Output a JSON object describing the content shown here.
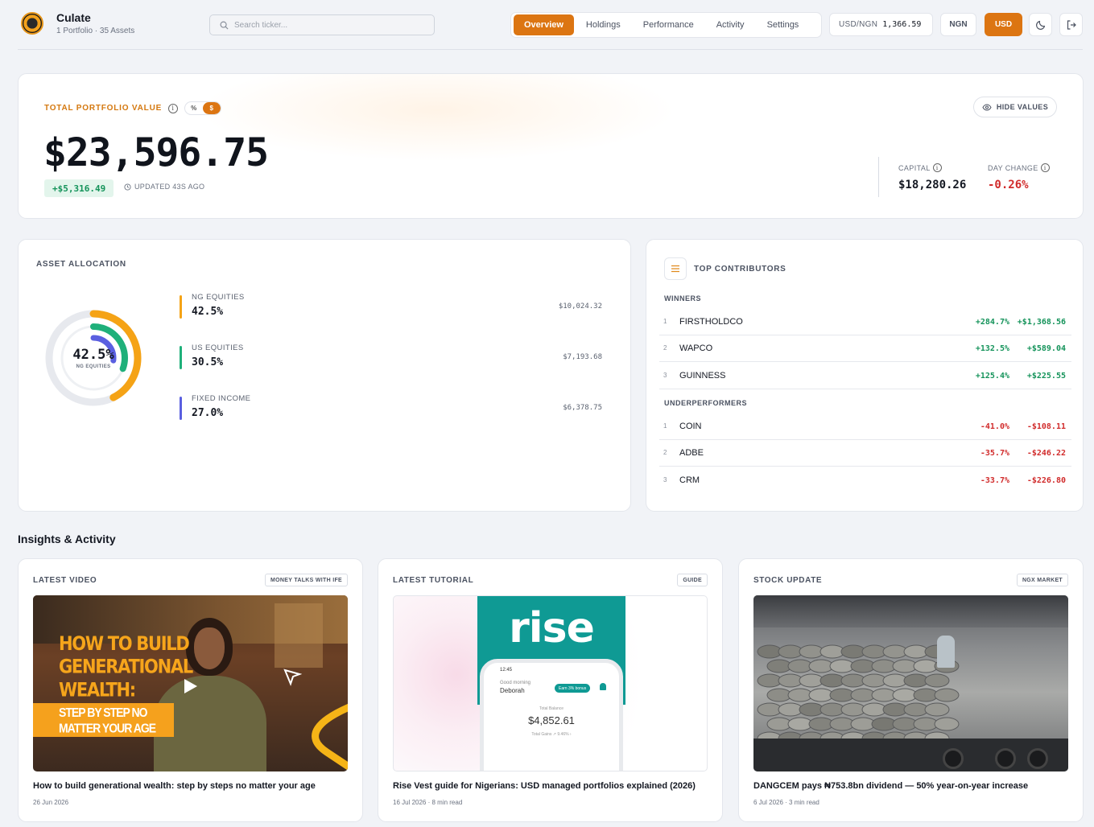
{
  "header": {
    "app_name": "Culate",
    "app_sub": "1 Portfolio · 35 Assets",
    "search_placeholder": "Search ticker...",
    "tabs": [
      {
        "label": "Overview",
        "active": true
      },
      {
        "label": "Holdings",
        "active": false
      },
      {
        "label": "Performance",
        "active": false
      },
      {
        "label": "Activity",
        "active": false
      },
      {
        "label": "Settings",
        "active": false
      }
    ],
    "fx_label": "USD/NGN",
    "fx_value": "1,366.59",
    "currency_ngn": "NGN",
    "currency_usd": "USD",
    "active_currency": "USD",
    "icons": [
      "moon-icon",
      "logout-icon"
    ]
  },
  "hero": {
    "label": "TOTAL PORTFOLIO VALUE",
    "toggle_pct": "%",
    "toggle_usd": "$",
    "hide_values": "HIDE VALUES",
    "total_value": "$23,596.75",
    "gain": "+$5,316.49",
    "updated": "UPDATED 43S AGO",
    "capital_label": "CAPITAL",
    "capital_value": "$18,280.26",
    "day_change_label": "DAY CHANGE",
    "day_change_value": "-0.26%"
  },
  "allocation": {
    "title": "ASSET ALLOCATION",
    "center_pct": "42.5%",
    "center_label": "NG EQUITIES",
    "items": [
      {
        "name": "NG EQUITIES",
        "pct": "42.5%",
        "share": 0.425,
        "amount": "$10,024.32",
        "color": "#f5a316"
      },
      {
        "name": "US EQUITIES",
        "pct": "30.5%",
        "share": 0.305,
        "amount": "$7,193.68",
        "color": "#1fb07a"
      },
      {
        "name": "FIXED INCOME",
        "pct": "27.0%",
        "share": 0.27,
        "amount": "$6,378.75",
        "color": "#5a5fe0"
      }
    ]
  },
  "contributors": {
    "title": "TOP CONTRIBUTORS",
    "winners_label": "WINNERS",
    "winners": [
      {
        "rank": "1",
        "name": "FIRSTHOLDCO",
        "pct": "+284.7%",
        "amount": "+$1,368.56"
      },
      {
        "rank": "2",
        "name": "WAPCO",
        "pct": "+132.5%",
        "amount": "+$589.04"
      },
      {
        "rank": "3",
        "name": "GUINNESS",
        "pct": "+125.4%",
        "amount": "+$225.55"
      }
    ],
    "losers_label": "UNDERPERFORMERS",
    "losers": [
      {
        "rank": "1",
        "name": "COIN",
        "pct": "-41.0%",
        "amount": "-$108.11"
      },
      {
        "rank": "2",
        "name": "ADBE",
        "pct": "-35.7%",
        "amount": "-$246.22"
      },
      {
        "rank": "3",
        "name": "CRM",
        "pct": "-33.7%",
        "amount": "-$226.80"
      }
    ]
  },
  "insights": {
    "title": "Insights & Activity",
    "cards": [
      {
        "label": "LATEST VIDEO",
        "tag": "MONEY TALKS WITH IFE",
        "title": "How to build generational wealth: step by steps no matter your age",
        "meta": "26 Jun 2026",
        "thumb_text_1": "HOW TO BUILD",
        "thumb_text_2": "GENERATIONAL",
        "thumb_text_3": "WEALTH:",
        "thumb_band_1": "STEP BY STEP NO",
        "thumb_band_2": "MATTER YOUR AGE"
      },
      {
        "label": "LATEST TUTORIAL",
        "tag": "GUIDE",
        "title": "Rise Vest guide for Nigerians: USD managed portfolios explained (2026)",
        "meta": "16 Jul 2026 · 8 min read",
        "thumb_logo": "rise",
        "phone_time": "12:45",
        "phone_greet": "Good morning",
        "phone_name": "Deborah",
        "phone_pill": "Earn 3% bonus",
        "phone_balance_label": "Total Balance",
        "phone_balance": "$4,852.61",
        "phone_gain": "Total Gains ↗ 9.46% ›"
      },
      {
        "label": "STOCK UPDATE",
        "tag": "NGX MARKET",
        "title": "DANGCEM pays ₦753.8bn dividend — 50% year-on-year increase",
        "meta": "6 Jul 2026 · 3 min read"
      }
    ]
  }
}
